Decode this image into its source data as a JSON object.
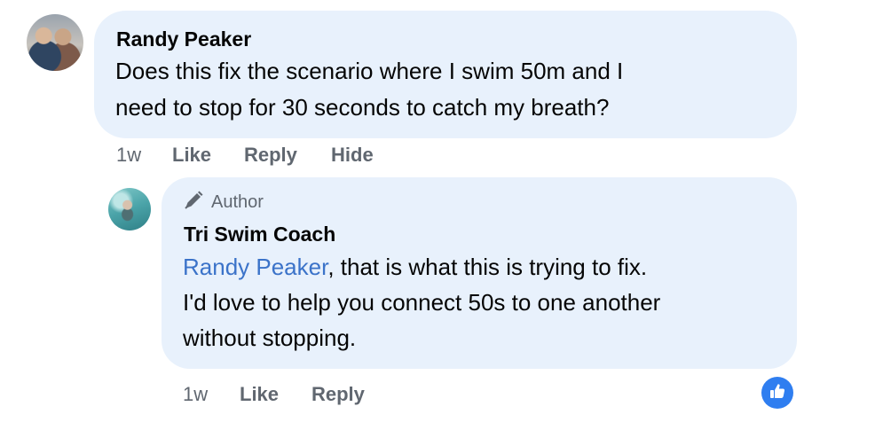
{
  "comment": {
    "author": "Randy Peaker",
    "lines": [
      "Does this fix the scenario where I swim 50m and I",
      "need to stop for 30 seconds to catch my breath?"
    ],
    "actions": {
      "time": "1w",
      "like": "Like",
      "reply": "Reply",
      "hide": "Hide"
    }
  },
  "reply": {
    "badge": "Author",
    "author": "Tri Swim Coach",
    "mention": "Randy Peaker",
    "line1_rest": ", that is what this is trying to fix.",
    "line2": "I'd love to help you connect 50s to one another",
    "line3": "without stopping.",
    "actions": {
      "time": "1w",
      "like": "Like",
      "reply": "Reply"
    }
  },
  "colors": {
    "bubble": "#e8f1fc",
    "mention": "#3b73c9",
    "meta": "#606770",
    "like_badge": "#2f7ef0"
  },
  "icons": [
    "pencil-icon",
    "thumbs-up-icon"
  ]
}
